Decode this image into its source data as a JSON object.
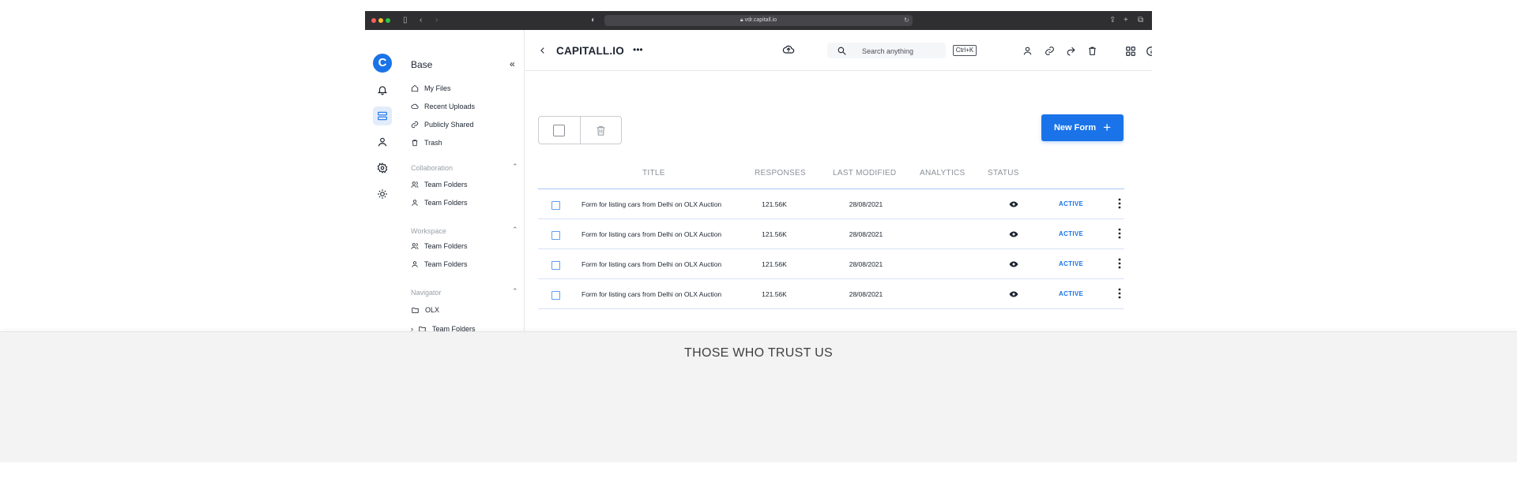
{
  "browser": {
    "url": "vdr.capitall.io",
    "traffic_colors": [
      "#ff5f57",
      "#febc2e",
      "#28c840"
    ]
  },
  "rail": {
    "logo_letter": "C",
    "icons": [
      "bell-icon",
      "storage-icon",
      "user-icon",
      "settings-icon",
      "sun-icon"
    ],
    "active": "storage-icon"
  },
  "sidebar": {
    "title": "Base",
    "items": [
      {
        "label": "My Files",
        "icon": "home-icon"
      },
      {
        "label": "Recent Uploads",
        "icon": "cloud-upload-icon"
      },
      {
        "label": "Publicly Shared",
        "icon": "link-icon"
      },
      {
        "label": "Trash",
        "icon": "trash-icon"
      }
    ],
    "collaboration": {
      "label": "Collaboration",
      "items": [
        {
          "label": "Team Folders",
          "icon": "users-icon"
        },
        {
          "label": "Team Folders",
          "icon": "user-icon"
        }
      ]
    },
    "workspace": {
      "label": "Workspace",
      "items": [
        {
          "label": "Team Folders",
          "icon": "users-icon"
        },
        {
          "label": "Team Folders",
          "icon": "user-icon"
        }
      ]
    },
    "navigator": {
      "label": "Navigator",
      "items": [
        {
          "label": "OLX",
          "icon": "folder-icon"
        },
        {
          "label": "Team Folders",
          "icon": "folder-icon"
        }
      ]
    }
  },
  "topbar": {
    "title": "CAPITALL.IO",
    "search_placeholder": "Search anything",
    "shortcut": "Ctrl+K"
  },
  "actions": {
    "new_form": "New Form"
  },
  "table": {
    "columns": [
      "TITLE",
      "RESPONSES",
      "LAST MODIFIED",
      "ANALYTICS",
      "STATUS"
    ],
    "rows": [
      {
        "title": "Form for listing cars from Delhi on OLX Auction",
        "responses": "121.56K",
        "modified": "28/08/2021",
        "status": "ACTIVE"
      },
      {
        "title": "Form for listing cars from Delhi on OLX Auction",
        "responses": "121.56K",
        "modified": "28/08/2021",
        "status": "ACTIVE"
      },
      {
        "title": "Form for listing cars from Delhi on OLX Auction",
        "responses": "121.56K",
        "modified": "28/08/2021",
        "status": "ACTIVE"
      },
      {
        "title": "Form for listing cars from Delhi on OLX Auction",
        "responses": "121.56K",
        "modified": "28/08/2021",
        "status": "ACTIVE"
      }
    ]
  },
  "footer": {
    "heading": "THOSE WHO TRUST US"
  },
  "colors": {
    "accent": "#1a73e8",
    "band": "#f3f3f3"
  }
}
